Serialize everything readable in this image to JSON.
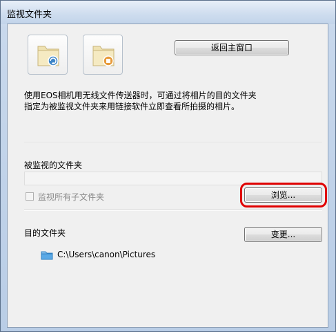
{
  "window": {
    "title": "监视文件夹"
  },
  "toolbar": {
    "monitor_icon": "folder-monitor-icon",
    "stop_icon": "folder-stop-icon",
    "return_label": "返回主窗口"
  },
  "description": {
    "line1": "使用EOS相机用无线文件传送器时，可通过将相片的目的文件夹",
    "line2": "指定为被监视文件夹来用链接软件立即查看所拍摄的相片。"
  },
  "monitored": {
    "label": "被监视的文件夹",
    "path_value": "",
    "subfolder_label": "监视所有子文件夹",
    "subfolder_checked": false,
    "browse_label": "浏览..."
  },
  "destination": {
    "label": "目的文件夹",
    "change_label": "变更...",
    "path": "C:\\Users\\canon\\Pictures"
  },
  "colors": {
    "highlight": "#e00000",
    "folder": "#5aa9e6"
  }
}
